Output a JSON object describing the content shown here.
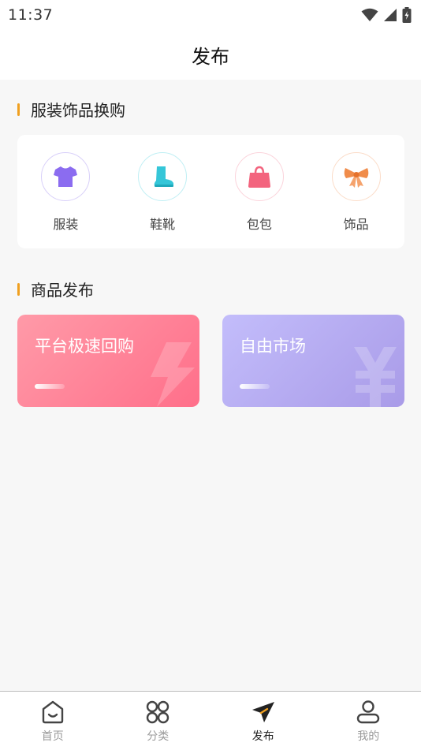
{
  "status_bar": {
    "time": "11:37"
  },
  "header": {
    "title": "发布"
  },
  "section_exchange": {
    "title": "服装饰品换购"
  },
  "categories": [
    {
      "label": "服装",
      "icon": "tshirt-icon",
      "color": "#8b6cf0"
    },
    {
      "label": "鞋靴",
      "icon": "boot-icon",
      "color": "#35c6d8"
    },
    {
      "label": "包包",
      "icon": "handbag-icon",
      "color": "#f3647e"
    },
    {
      "label": "饰品",
      "icon": "bow-icon",
      "color": "#f08c4a"
    }
  ],
  "section_publish": {
    "title": "商品发布"
  },
  "publish_cards": [
    {
      "title": "平台极速回购",
      "icon": "lightning-icon"
    },
    {
      "title": "自由市场",
      "icon": "yen-icon"
    }
  ],
  "tabbar": {
    "items": [
      {
        "label": "首页",
        "icon": "home-icon"
      },
      {
        "label": "分类",
        "icon": "category-icon"
      },
      {
        "label": "发布",
        "icon": "send-icon",
        "active": true
      },
      {
        "label": "我的",
        "icon": "user-icon"
      }
    ]
  }
}
